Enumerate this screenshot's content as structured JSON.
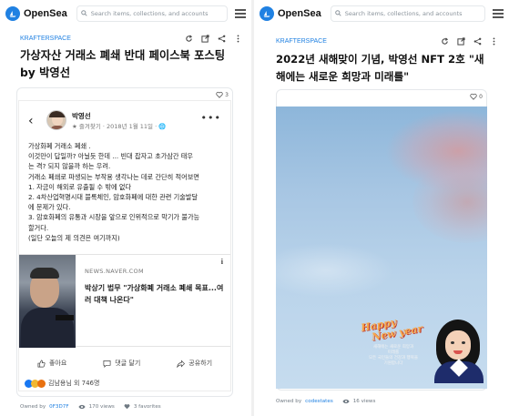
{
  "left": {
    "brand": "OpenSea",
    "search_placeholder": "Search items, collections, and accounts",
    "collection": "KRAFTERSPACE",
    "title_line1": "가상자산 거래소 폐쇄 반대 페이스북 포스팅",
    "title_line2": "by 박영선",
    "likes": "3",
    "post": {
      "name": "박영선",
      "meta": "★ 즐겨찾기 · 2018년 1월 11일 · 🌐",
      "lines": [
        "가상화폐 거래소 폐쇄 .",
        "이것만이 답일까? 아닐듯 한데 ... 빈대 잡자고 초가삼간 태우",
        "는 격? 되지 않을까 하는 우려.",
        "거래소 폐쇄로 파생되는 부작용 생각나는 데로 간단히 적어보면",
        "1. 자금이 해외로 유출될 수 밖에 없다",
        "2. 4차산업혁명시대 블록체인, 암호화폐에 대한 관련 기술발달",
        "에 문제가 있다.",
        "3. 암호화폐의 유통과 시장을 앞으로 인위적으로 막기가 불가능",
        "할거다.",
        "(일단 오늘의 제 의견은 여기까지)"
      ],
      "link_info": "i",
      "link_domain": "NEWS.NAVER.COM",
      "link_title": "박상기 법무 \"가상화폐 거래소 폐쇄 목표...여러 대책 나온다\"",
      "like_label": "좋아요",
      "comment_label": "댓글 달기",
      "share_label": "공유하기",
      "reactions": "김남용님 외 746명"
    },
    "owner_label": "Owned by",
    "owner": "0F3D7F",
    "views": "170 views",
    "favorites": "3 favorites"
  },
  "right": {
    "brand": "OpenSea",
    "search_placeholder": "Search items, collections, and accounts",
    "collection": "KRAFTERSPACE",
    "title_line1": "2022년 새해맞이 기념, 박영선 NFT 2호 \"새",
    "title_line2": "해에는 새로운 희망과 미래를\"",
    "likes": "0",
    "greeting_line1": "Happy",
    "greeting_line2": "New year",
    "message_lines": [
      "새해에는 새로운 희망과",
      "미래를",
      "모든 국민들의 건강과 행복을",
      "기원합니다"
    ],
    "owner_label": "Owned by",
    "owner": "codestates",
    "views": "16 views"
  },
  "colors": {
    "accent": "#2081e2",
    "greeting": "#f7a74a"
  }
}
